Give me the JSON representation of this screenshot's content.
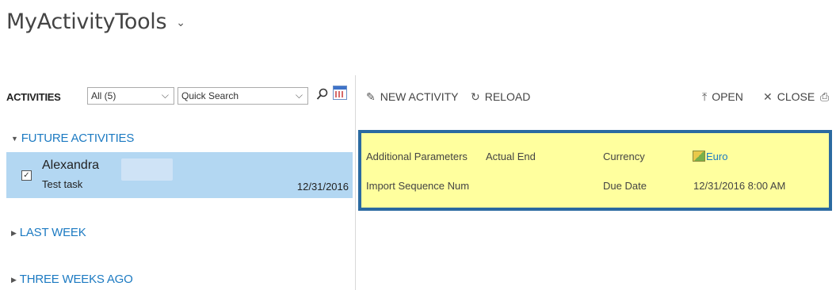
{
  "app": {
    "title": "MyActivityTools"
  },
  "left_toolbar": {
    "label": "ACTIVITIES",
    "view_value": "All (5)",
    "search_placeholder": "Quick Search"
  },
  "groups": {
    "future": "FUTURE ACTIVITIES",
    "last_week": "LAST WEEK",
    "three_weeks": "THREE WEEKS AGO"
  },
  "activity": {
    "name": "Alexandra",
    "subject": "Test task",
    "date": "12/31/2016"
  },
  "right_toolbar": {
    "new_activity": "NEW ACTIVITY",
    "reload": "RELOAD",
    "open": "OPEN",
    "close": "CLOSE"
  },
  "details": {
    "additional_parameters": "Additional Parameters",
    "actual_end": "Actual End",
    "currency_label": "Currency",
    "currency_value": "Euro",
    "import_sequence": "Import Sequence Num",
    "due_date_label": "Due Date",
    "due_date_value": "12/31/2016 8:00 AM"
  },
  "colors": {
    "accent": "#1c7ac2",
    "selected_row": "#b3d7f2",
    "highlight": "#ffff9e",
    "highlight_border": "#2b6aa1"
  }
}
